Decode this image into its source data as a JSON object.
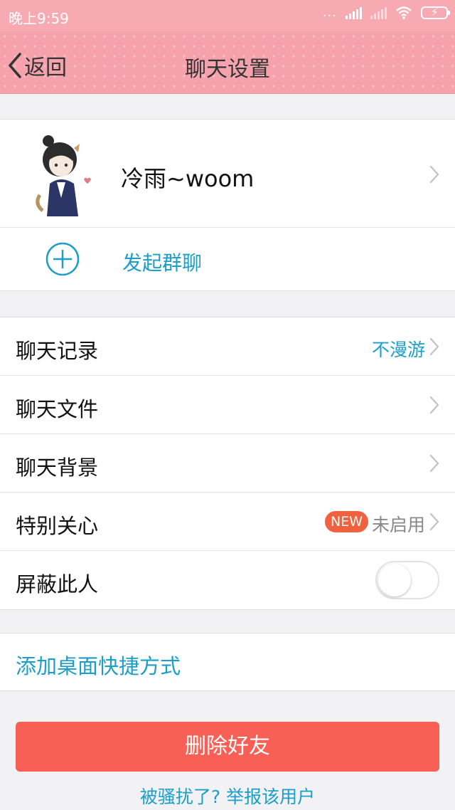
{
  "status_bar": {
    "time": "晚上9:59",
    "signal_dots": "..."
  },
  "header": {
    "back_label": "返回",
    "title": "聊天设置"
  },
  "profile": {
    "name": "冷雨~woom"
  },
  "group_chat": {
    "label": "发起群聊"
  },
  "settings": {
    "chat_history": {
      "label": "聊天记录",
      "value": "不漫游"
    },
    "chat_files": {
      "label": "聊天文件"
    },
    "chat_background": {
      "label": "聊天背景"
    },
    "special_care": {
      "label": "特别关心",
      "badge": "NEW",
      "value": "未启用"
    },
    "block_user": {
      "label": "屏蔽此人",
      "toggle_on": false
    }
  },
  "shortcut": {
    "label": "添加桌面快捷方式"
  },
  "delete_button": {
    "label": "删除好友"
  },
  "report_link": {
    "label": "被骚扰了? 举报该用户"
  },
  "colors": {
    "accent_blue": "#1b9ec8",
    "header_pink": "#f5a2ad",
    "delete_red": "#f85f55",
    "badge_orange": "#f0623f"
  }
}
